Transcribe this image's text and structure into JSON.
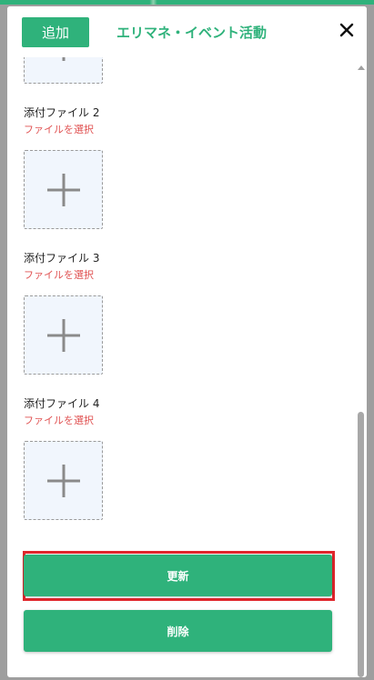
{
  "header": {
    "add_label": "追加",
    "title": "エリマネ・イベント活動"
  },
  "attachments": [
    {
      "label": "添付ファイル 2",
      "select_label": "ファイルを選択"
    },
    {
      "label": "添付ファイル 3",
      "select_label": "ファイルを選択"
    },
    {
      "label": "添付ファイル 4",
      "select_label": "ファイルを選択"
    }
  ],
  "actions": {
    "update_label": "更新",
    "delete_label": "削除"
  },
  "icons": {
    "close": "close-icon",
    "plus": "plus-icon",
    "scroll_up": "scroll-up-arrow-icon"
  },
  "colors": {
    "accent": "#2fb27b",
    "select_text": "#e05252",
    "highlight": "#e0262c"
  }
}
